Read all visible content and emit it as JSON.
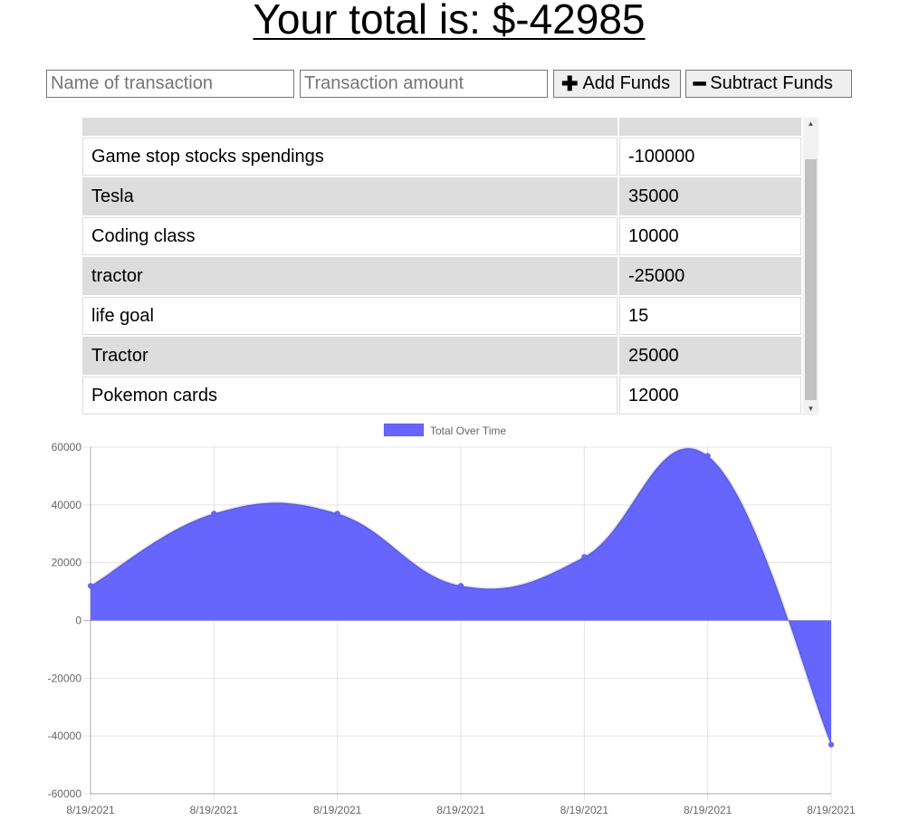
{
  "header": {
    "total_label": "Your total is: $-42985"
  },
  "form": {
    "name_placeholder": "Name of transaction",
    "amount_placeholder": "Transaction amount",
    "add_label": "Add Funds",
    "subtract_label": "Subtract Funds",
    "add_icon": "plus-icon",
    "subtract_icon": "minus-icon"
  },
  "transactions": [
    {
      "name": "",
      "value": ""
    },
    {
      "name": "Game stop stocks spendings",
      "value": "-100000"
    },
    {
      "name": "Tesla",
      "value": "35000"
    },
    {
      "name": "Coding class",
      "value": "10000"
    },
    {
      "name": "tractor",
      "value": "-25000"
    },
    {
      "name": "life goal",
      "value": "15"
    },
    {
      "name": "Tractor",
      "value": "25000"
    },
    {
      "name": "Pokemon cards",
      "value": "12000"
    }
  ],
  "chart_data": {
    "type": "line",
    "fill": true,
    "legend": "top",
    "grid": true,
    "categories": [
      "8/19/2021",
      "8/19/2021",
      "8/19/2021",
      "8/19/2021",
      "8/19/2021",
      "8/19/2021",
      "8/19/2021"
    ],
    "series": [
      {
        "name": "Total Over Time",
        "values": [
          12000,
          37000,
          37015,
          12015,
          22015,
          57015,
          -42985
        ],
        "color": "#6666ff"
      }
    ],
    "ylim": [
      -60000,
      60000
    ],
    "yticks": [
      60000,
      40000,
      20000,
      0,
      -20000,
      -40000,
      -60000
    ],
    "title": "",
    "xlabel": "",
    "ylabel": ""
  }
}
